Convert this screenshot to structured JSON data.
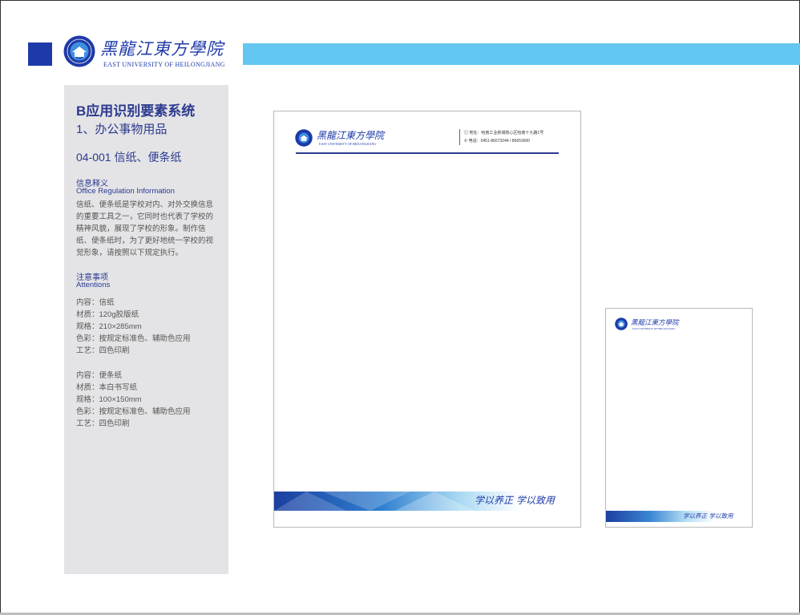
{
  "header": {
    "school_name_cn": "黑龍江東方學院",
    "school_name_en": "EAST UNIVERSITY OF HEILONGJIANG"
  },
  "sidebar": {
    "title": "B应用识别要素系统",
    "subtitle": "1、办公事物用品",
    "code": "04-001 信纸、便条纸",
    "info_head_cn": "信息释义",
    "info_head_en": "Office Regulation Information",
    "info_body": "信纸、便条纸是学校对内、对外交换信息的重要工具之一，它同时也代表了学校的精神风貌，展现了学校的形象。制作信纸、便条纸时，为了更好地统一学校的视觉形象，请按照以下规定执行。",
    "attn_head_cn": "注意事项",
    "attn_head_en": "Attentions",
    "spec1": [
      "内容：信纸",
      "材质：120g胶版纸",
      "规格：210×285mm",
      "色彩：按规定标准色、辅助色应用",
      "工艺：四色印刷"
    ],
    "spec2": [
      "内容：便条纸",
      "材质：本白书写纸",
      "规格：100×150mm",
      "色彩：按规定标准色、辅助色应用",
      "工艺：四色印刷"
    ]
  },
  "letterhead": {
    "address": "地址：哈南工业新城核心区哈南十九路1号",
    "phone": "电话：0451-86673244 / 86653600",
    "motto": "学以养正  学以致用"
  },
  "colors": {
    "brand_blue": "#1e3aa8",
    "top_bar": "#63c7f1",
    "sidebar_bg": "#e4e4e6",
    "heading": "#2c3a8f"
  },
  "icons": [
    "university-emblem-icon",
    "location-icon",
    "phone-icon"
  ]
}
